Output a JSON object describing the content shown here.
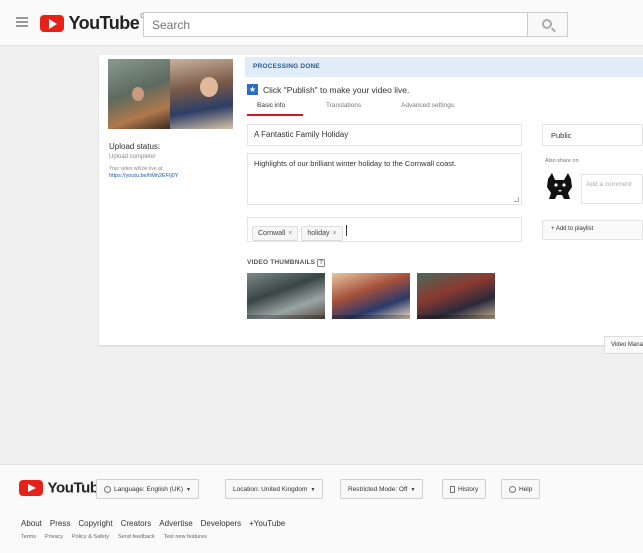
{
  "masthead": {
    "logo_text": "YouTube",
    "logo_region": "GB",
    "search_placeholder": "Search"
  },
  "upload": {
    "status_heading": "Upload status:",
    "status_text": "Upload complete!",
    "link_label": "Your video will be live at:",
    "link_url": "https://youtu.be/hMn2EFIj0Y",
    "processing_banner": "PROCESSING DONE",
    "publish_hint": "Click \"Publish\" to make your video live."
  },
  "tabs": [
    {
      "label": "Basic info"
    },
    {
      "label": "Translations"
    },
    {
      "label": "Advanced settings"
    }
  ],
  "form": {
    "title": "A Fantastic Family Holiday",
    "description": "Highlights of our brilliant winter holiday to the Cornwall coast.",
    "tags": [
      "Cornwall",
      "holiday"
    ],
    "thumbnails_label": "VIDEO THUMBNAILS",
    "privacy": "Public",
    "also_share": "Also share on",
    "comment_placeholder": "Add a comment",
    "add_to_playlist": "+ Add to playlist",
    "video_manager": "Video Manager"
  },
  "footer": {
    "logo_text": "YouTube",
    "language": "Language: English (UK)",
    "location": "Location: United Kingdom",
    "restricted": "Restricted Mode: Off",
    "history": "History",
    "help": "Help",
    "links": [
      "About",
      "Press",
      "Copyright",
      "Creators",
      "Advertise",
      "Developers",
      "+YouTube"
    ],
    "links2": [
      "Terms",
      "Privacy",
      "Policy & Safety",
      "Send feedback",
      "Test new features"
    ]
  },
  "colors": {
    "brand_red": "#e62117",
    "link_blue": "#1a5ea8",
    "banner_bg": "#e0ecf8"
  }
}
